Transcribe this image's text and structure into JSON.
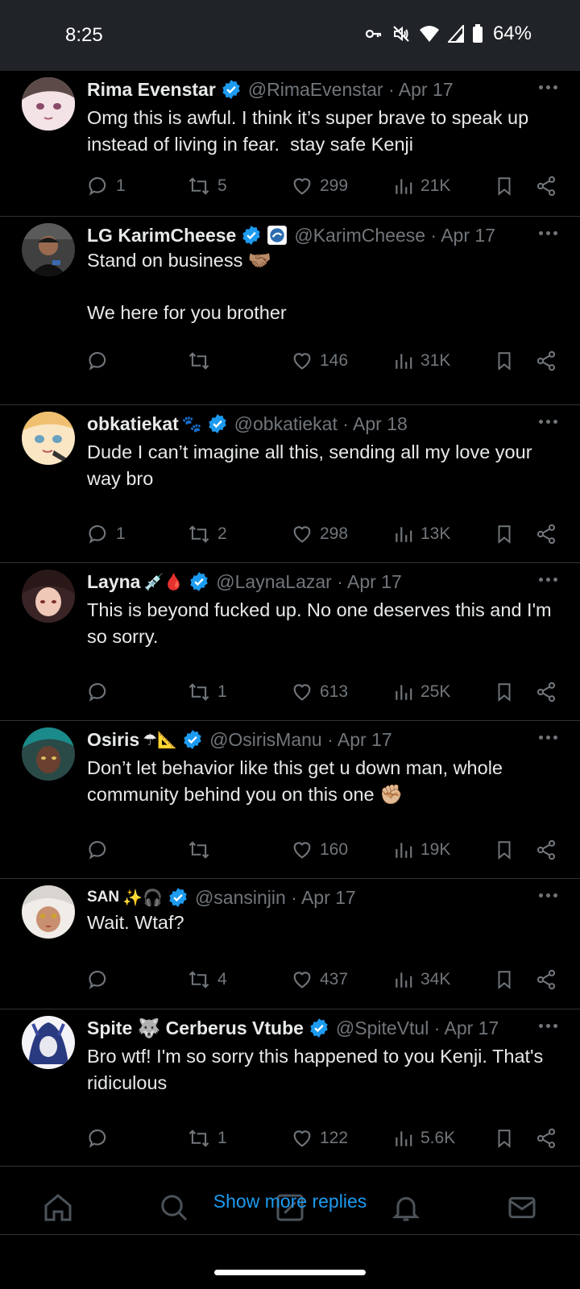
{
  "status": {
    "time": "8:25",
    "battery": "64%",
    "icons": [
      "key-icon",
      "mute-icon",
      "wifi-icon",
      "signal-icon",
      "battery-icon"
    ]
  },
  "replies": [
    {
      "name": "Rima Evenstar",
      "emoji": "",
      "handle": "@RimaEvenstar · Apr 17",
      "text": "Omg this is awful. I think it’s super brave to speak up instead of living in fear.  stay safe Kenji",
      "replies": "1",
      "retweets": "5",
      "likes": "299",
      "views": "21K",
      "avatar_color": "#f2dbe0"
    },
    {
      "name": "LG KarimCheese",
      "emoji": "",
      "handle": "@KarimCheese · Apr 17",
      "text": "Stand on business 🤝🏽\n\nWe here for you brother",
      "replies": "",
      "retweets": "",
      "likes": "146",
      "views": "31K",
      "avatar_color": "#3a3a3a"
    },
    {
      "name": "obkatiekat",
      "emoji": "🐾",
      "handle": "@obkatiekat · Apr 18",
      "text": "Dude I can’t imagine all this, sending all my love your way bro",
      "replies": "1",
      "retweets": "2",
      "likes": "298",
      "views": "13K",
      "avatar_color": "#f4d7a8"
    },
    {
      "name": "Layna",
      "emoji": "💉🩸",
      "handle": "@LaynaLazar · Apr 17",
      "text": "This is beyond fucked up. No one deserves this and I'm so sorry.",
      "replies": "",
      "retweets": "1",
      "likes": "613",
      "views": "25K",
      "avatar_color": "#5a3a38"
    },
    {
      "name": "Osiris",
      "emoji": "☂📐",
      "handle": "@OsirisManu · Apr 17",
      "text": "Don’t let behavior like this get u down man, whole community behind you on this one ✊🏼",
      "replies": "",
      "retweets": "",
      "likes": "160",
      "views": "19K",
      "avatar_color": "#2d6a6a"
    },
    {
      "name": "SAN",
      "emoji": "✨🎧",
      "handle": "@sansinjin · Apr 17",
      "text": "Wait. Wtaf?",
      "replies": "",
      "retweets": "4",
      "likes": "437",
      "views": "34K",
      "avatar_color": "#e8e4e0"
    },
    {
      "name": "Spite 🐺 Cerberus Vtube",
      "emoji": "",
      "handle": "@SpiteVtul · Apr 17",
      "text": "Bro wtf! I'm so sorry this happened to you Kenji. That's ridiculous",
      "replies": "",
      "retweets": "1",
      "likes": "122",
      "views": "5.6K",
      "avatar_color": "#2a3a6a"
    }
  ],
  "show_more": "Show more replies",
  "nav": [
    "home-icon",
    "search-icon",
    "compose-icon",
    "notifications-icon",
    "messages-icon"
  ],
  "colors": {
    "background": "#000000",
    "muted": "#71767b",
    "accent": "#1d9bf0",
    "verified": "#1d9bf0"
  }
}
